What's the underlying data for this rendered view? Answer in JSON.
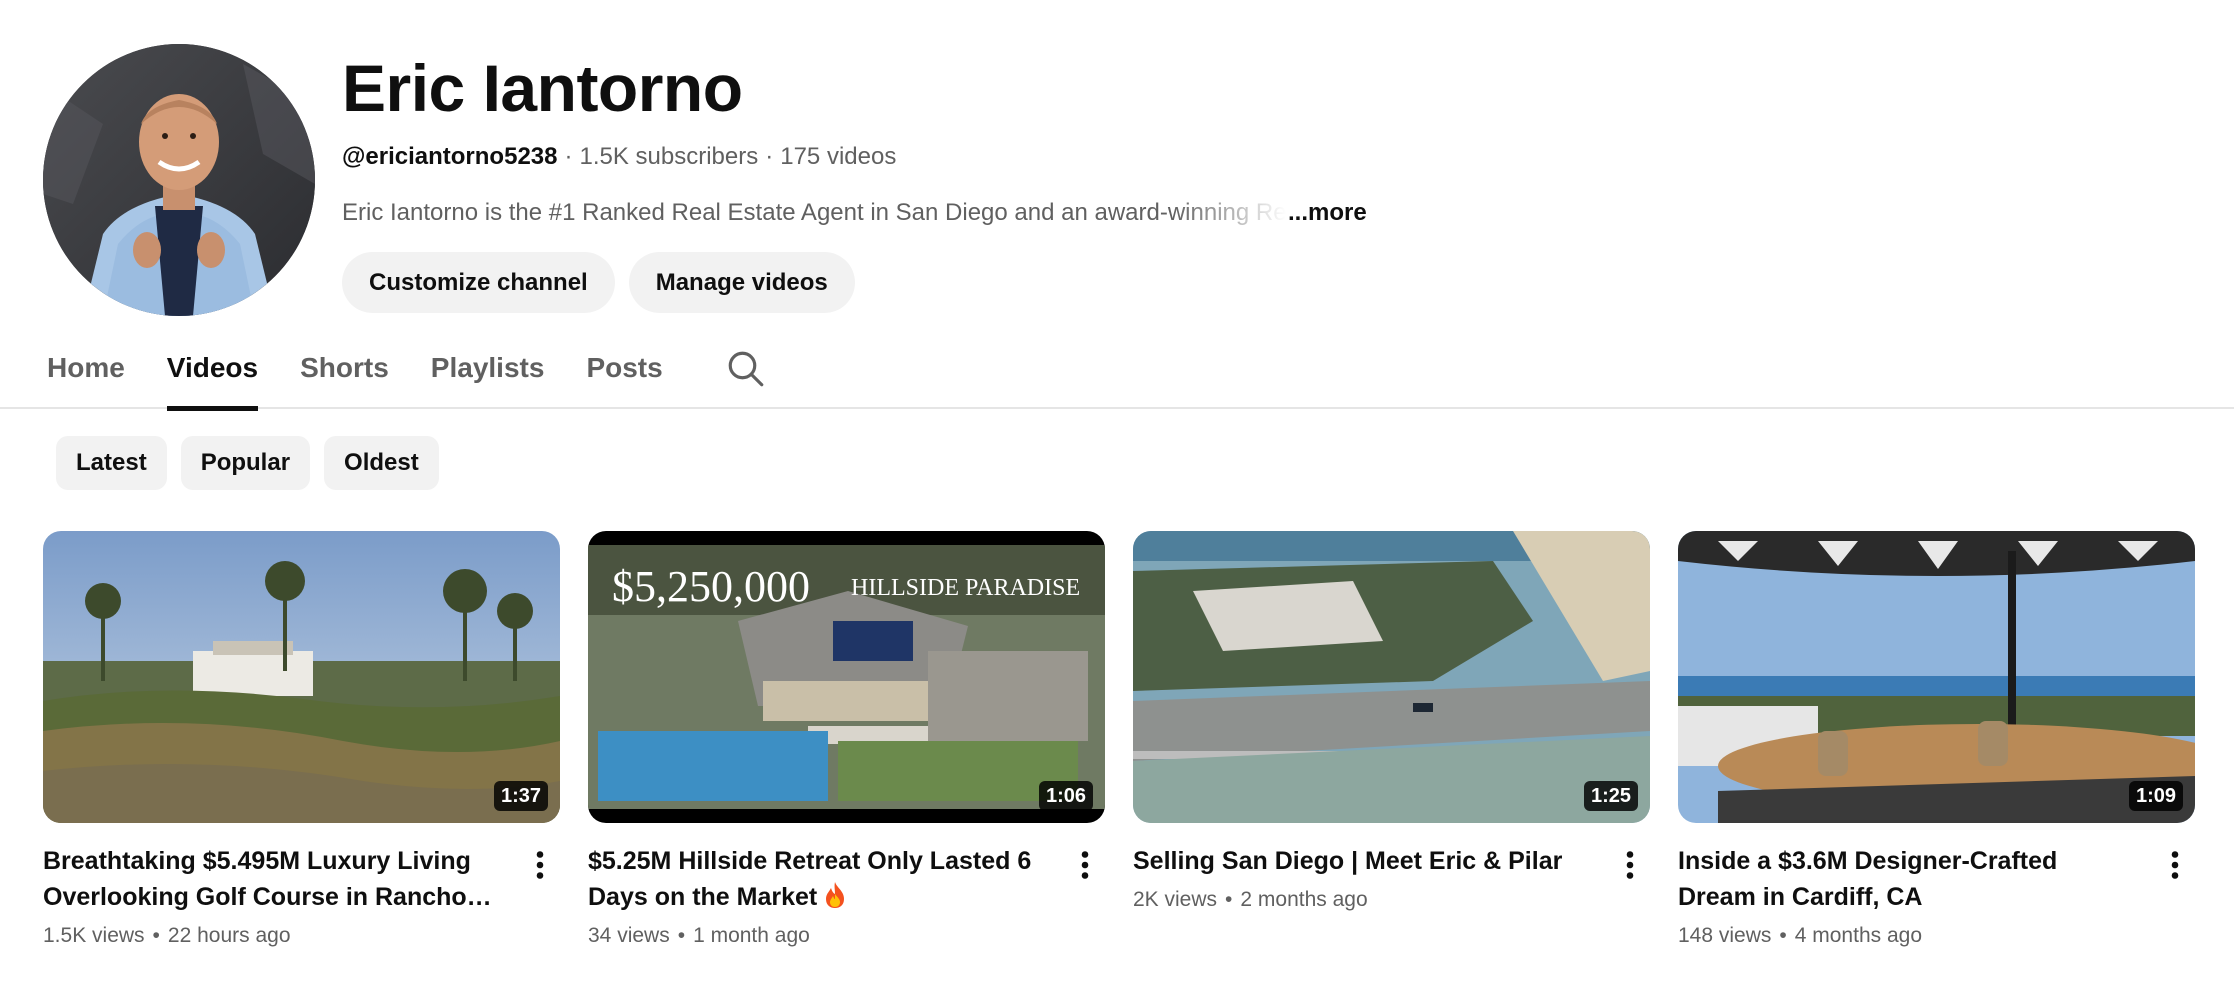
{
  "channel": {
    "name": "Eric Iantorno",
    "handle": "@ericiantorno5238",
    "subscribers": "1.5K subscribers",
    "video_count": "175 videos",
    "separator": "·",
    "description": "Eric Iantorno is the #1 Ranked Real Estate Agent in San Diego and an award-winning Real",
    "more_label": "...more",
    "buttons": {
      "customize": "Customize channel",
      "manage": "Manage videos"
    }
  },
  "tabs": [
    {
      "label": "Home",
      "active": false
    },
    {
      "label": "Videos",
      "active": true
    },
    {
      "label": "Shorts",
      "active": false
    },
    {
      "label": "Playlists",
      "active": false
    },
    {
      "label": "Posts",
      "active": false
    }
  ],
  "tab_search_icon": "search-icon",
  "sort_chips": [
    "Latest",
    "Popular",
    "Oldest"
  ],
  "videos": [
    {
      "title": "Breathtaking $5.495M Luxury Living Overlooking Golf Course in Rancho Santa F…",
      "views": "1.5K views",
      "age": "22 hours ago",
      "duration": "1:37"
    },
    {
      "title": "$5.25M Hillside Retreat Only Lasted 6 Days on the Market",
      "emoji": "fire-emoji-icon",
      "views": "34 views",
      "age": "1 month ago",
      "duration": "1:06",
      "overlay_price": "$5,250,000",
      "overlay_caption": "HILLSIDE PARADISE"
    },
    {
      "title": "Selling San Diego | Meet Eric & Pilar",
      "views": "2K views",
      "age": "2 months ago",
      "duration": "1:25"
    },
    {
      "title": "Inside a $3.6M Designer-Crafted Dream in Cardiff, CA",
      "views": "148 views",
      "age": "4 months ago",
      "duration": "1:09"
    }
  ],
  "meta_separator": "•",
  "colors": {
    "text_primary": "#0f0f0f",
    "text_secondary": "#606060",
    "chip_bg": "#f2f2f2",
    "tab_underline": "#0f0f0f"
  }
}
